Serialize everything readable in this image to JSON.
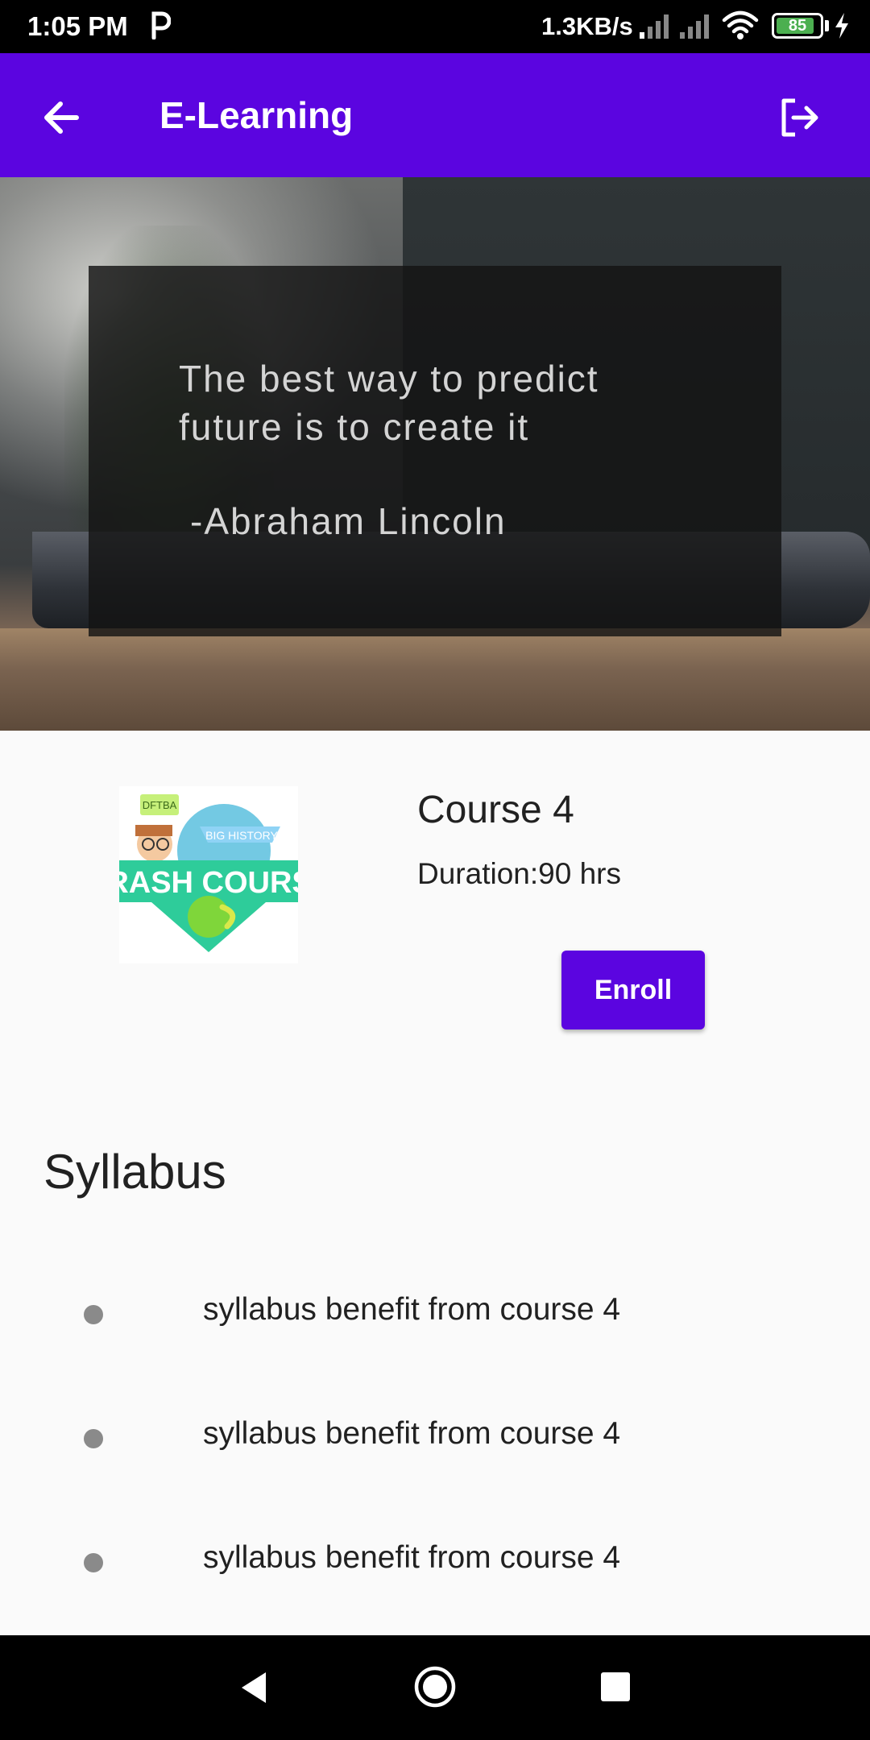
{
  "status_bar": {
    "time": "1:05 PM",
    "network_speed": "1.3KB/s",
    "battery_level": "85",
    "battery_fraction": 0.85,
    "icons": [
      "p-icon",
      "signal-icon",
      "signal-icon",
      "wifi-icon",
      "battery-icon",
      "charging-icon"
    ]
  },
  "app_bar": {
    "title": "E-Learning",
    "background": "#5b05e0",
    "back_icon": "arrow-left-icon",
    "logout_icon": "logout-icon"
  },
  "hero": {
    "quote_line1": "The best way to predict",
    "quote_line2": "future is to create it",
    "author": "-Abraham Lincoln"
  },
  "course": {
    "name": "Course 4",
    "duration": "Duration:90 hrs",
    "enroll_label": "Enroll",
    "thumbnail": {
      "badge": "DFTBA",
      "subtitle": "BIG HISTORY",
      "title": "CRASH COURSE"
    }
  },
  "syllabus": {
    "title": "Syllabus",
    "items": [
      "syllabus benefit from course 4",
      "syllabus benefit from course 4",
      "syllabus benefit from course 4"
    ]
  },
  "nav_bar": {
    "icons": [
      "nav-back-icon",
      "nav-home-icon",
      "nav-recents-icon"
    ]
  }
}
